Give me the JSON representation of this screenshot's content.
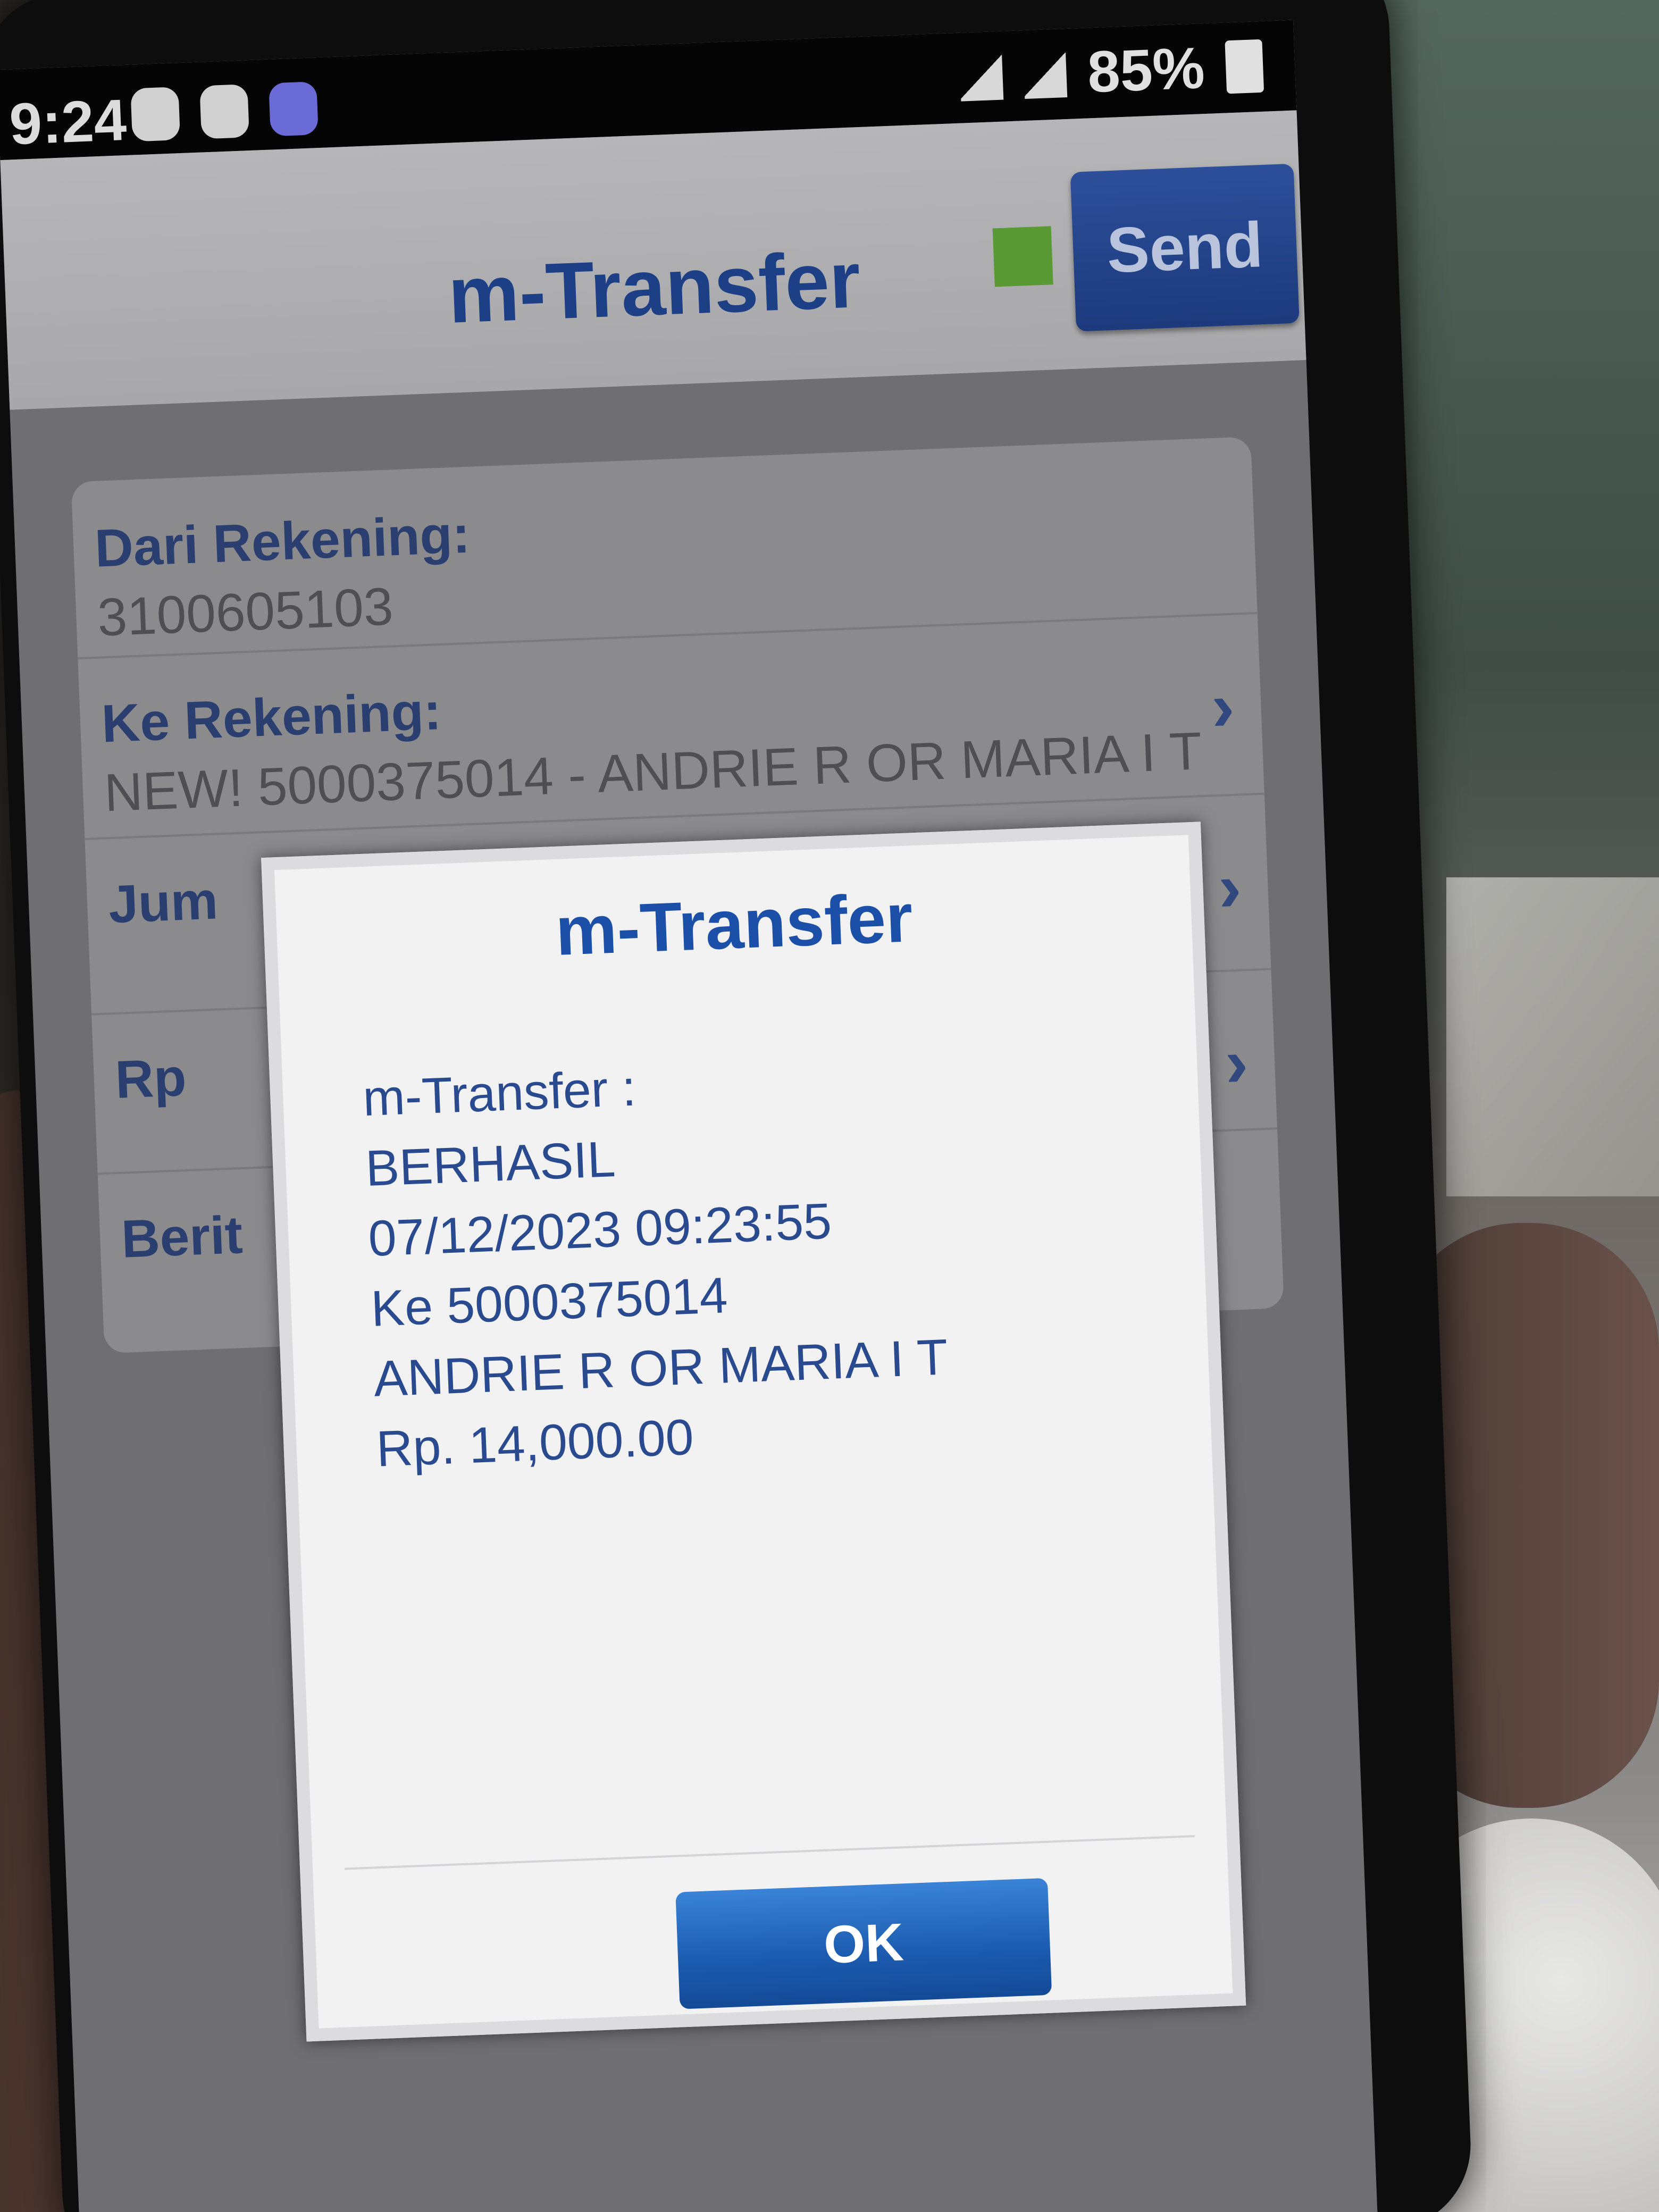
{
  "status_bar": {
    "time": "9:24",
    "battery": "85%"
  },
  "app": {
    "title": "m-Transfer",
    "send_label": "Send"
  },
  "form": {
    "rows": [
      {
        "label": "Dari Rekening:",
        "value": "3100605103"
      },
      {
        "label": "Ke Rekening:",
        "value": "NEW! 5000375014 - ANDRIE R OR MARIA I T"
      },
      {
        "label": "Jum",
        "value": ""
      },
      {
        "label": "Rp",
        "value": ""
      },
      {
        "label": "Berit",
        "value": ""
      }
    ]
  },
  "dialog": {
    "title": "m-Transfer",
    "lines": [
      "m-Transfer :",
      "BERHASIL",
      "07/12/2023 09:23:55",
      "Ke 5000375014",
      "ANDRIE R OR MARIA I T",
      "Rp. 14,000.00"
    ],
    "ok_label": "OK"
  },
  "colors": {
    "accent_blue": "#1d3f86",
    "ok_button": "#1b5bb0",
    "indicator_green": "#5a9a35"
  }
}
